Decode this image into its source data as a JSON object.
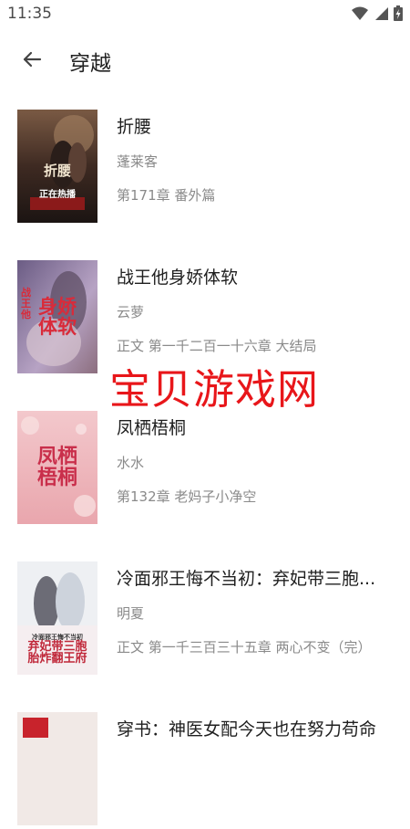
{
  "status": {
    "time": "11:35"
  },
  "header": {
    "title": "穿越"
  },
  "books": [
    {
      "title": "折腰",
      "author": "蓬莱客",
      "chapter": "第171章 番外篇",
      "cover_text": "折腰",
      "cover_badge": "正在热播"
    },
    {
      "title": "战王他身娇体软",
      "author": "云萝",
      "chapter": "正文 第一千二百一十六章 大结局",
      "cover_text": "身娇体软",
      "cover_side": "战王他"
    },
    {
      "title": "凤栖梧桐",
      "author": "水水",
      "chapter": "第132章 老妈子小净空",
      "cover_text": "凤栖梧桐"
    },
    {
      "title": "冷面邪王悔不当初：弃妃带三胞...",
      "author": "明夏",
      "chapter": "正文 第一千三百三十五章 两心不变（完）",
      "cover_text": "冷面邪王悔不当初",
      "cover_sub": "弃妃带三胞胎炸翻王府"
    },
    {
      "title": "穿书：神医女配今天也在努力苟命",
      "author": "",
      "chapter": "",
      "cover_text": ""
    }
  ],
  "watermark": "宝贝游戏网",
  "colors": {
    "watermark": "#e8161a",
    "title": "#1f1f1f",
    "meta": "#8a8a8a"
  }
}
